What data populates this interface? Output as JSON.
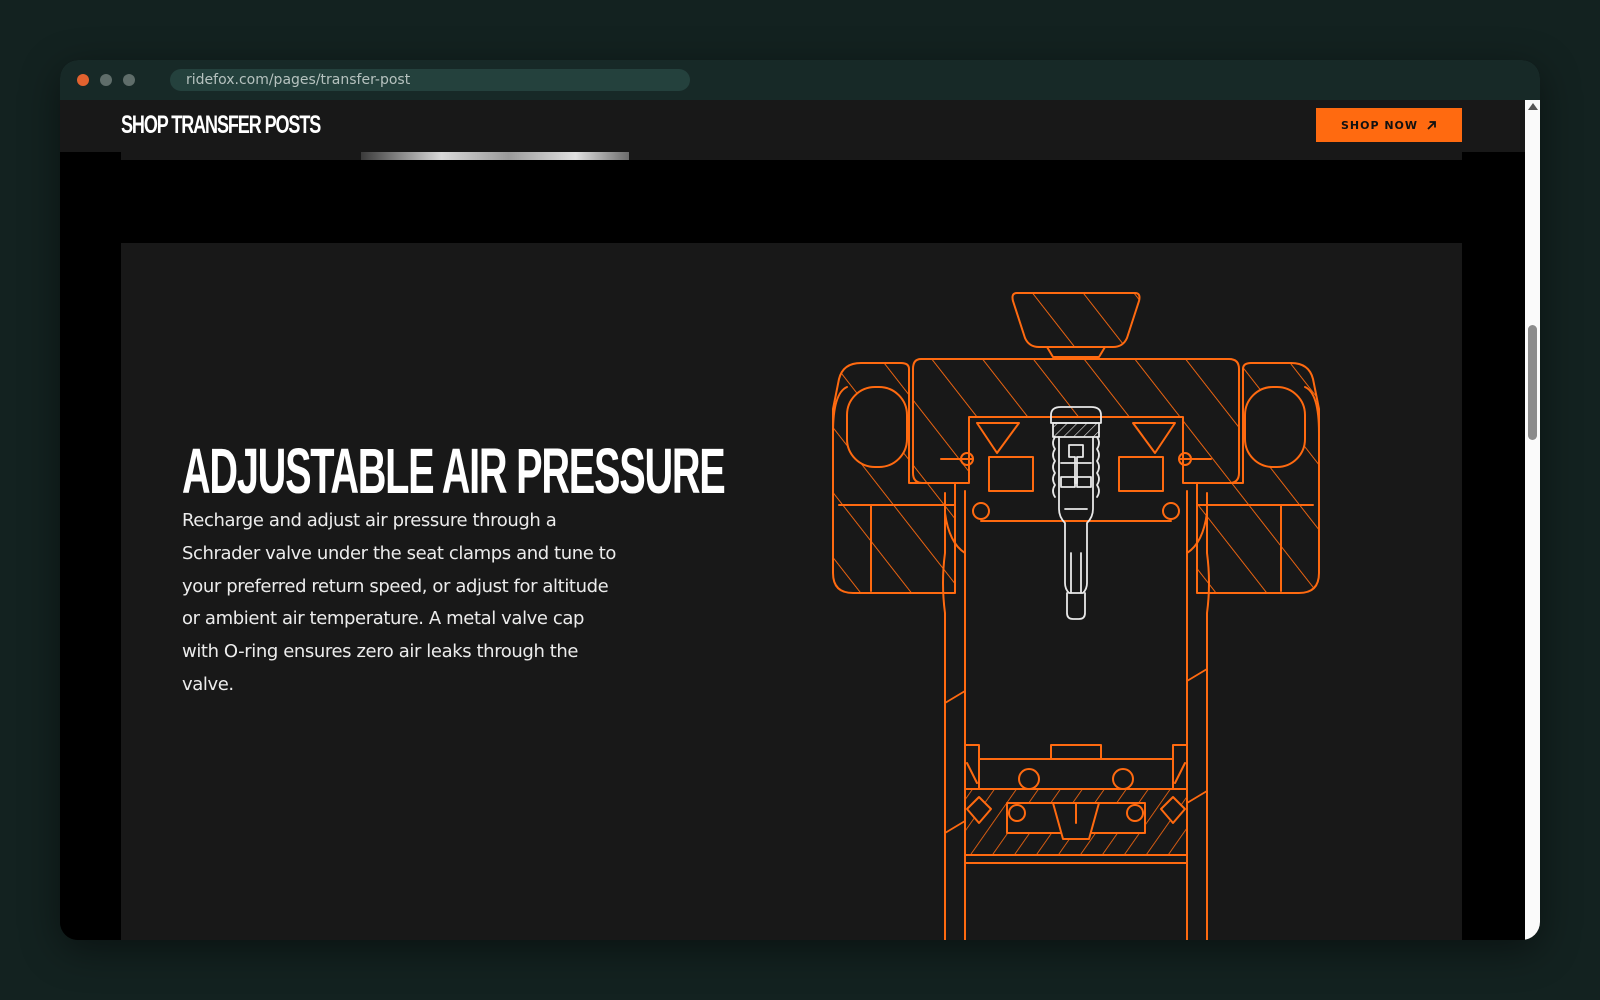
{
  "browser": {
    "url": "ridefox.com/pages/transfer-post"
  },
  "nav": {
    "brand": "SHOP TRANSFER POSTS",
    "cta_label": "SHOP NOW"
  },
  "feature": {
    "title": "ADJUSTABLE AIR PRESSURE",
    "body": "Recharge and adjust air pressure through a Schrader valve under the seat clamps and tune to your preferred return speed, or adjust for altitude or ambient air temperature. A metal valve cap with O-ring ensures zero air leaks through the valve."
  },
  "colors": {
    "accent": "#ff6a10",
    "diagram_line": "#ff6a10",
    "valve_line": "#e8e8e8",
    "panel": "#181818",
    "page_background": "#000000"
  },
  "icons": {
    "cta_icon": "arrow-up-right-icon"
  }
}
